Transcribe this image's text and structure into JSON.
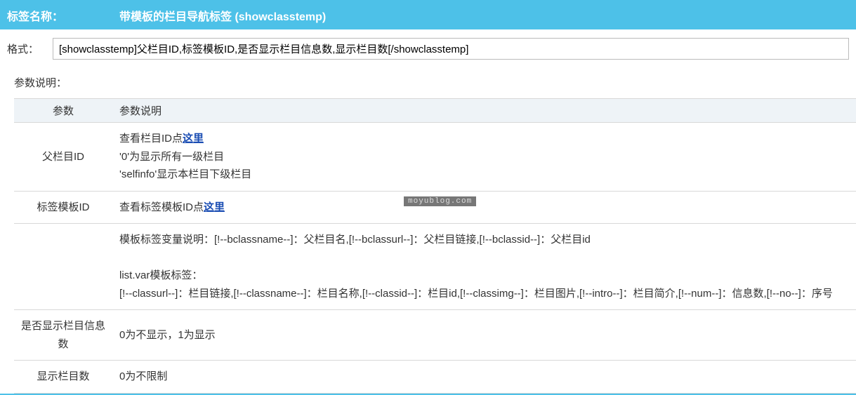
{
  "header": {
    "label": "标签名称：",
    "title": "带模板的栏目导航标签 (showclasstemp)"
  },
  "format": {
    "label": "格式：",
    "value": "[showclasstemp]父栏目ID,标签模板ID,是否显示栏目信息数,显示栏目数[/showclasstemp]"
  },
  "section_title": "参数说明：",
  "table": {
    "headers": {
      "col1": "参数",
      "col2": "参数说明"
    },
    "rows": [
      {
        "name": "父栏目ID",
        "desc_pre": "查看栏目ID点",
        "link": "这里",
        "desc_line2": "'0'为显示所有一级栏目",
        "desc_line3": "'selfinfo'显示本栏目下级栏目"
      },
      {
        "name": "标签模板ID",
        "desc_pre": "查看标签模板ID点",
        "link": "这里"
      },
      {
        "name": "",
        "desc_line1": "模板标签变量说明：[!--bclassname--]：父栏目名,[!--bclassurl--]：父栏目链接,[!--bclassid--]：父栏目id",
        "desc_line2": "list.var模板标签：",
        "desc_line3": "[!--classurl--]：栏目链接,[!--classname--]：栏目名称,[!--classid--]：栏目id,[!--classimg--]：栏目图片,[!--intro--]：栏目简介,[!--num--]：信息数,[!--no--]：序号"
      },
      {
        "name": "是否显示栏目信息数",
        "desc": "0为不显示，1为显示"
      },
      {
        "name": "显示栏目数",
        "desc": "0为不限制"
      }
    ]
  },
  "watermark": "moyublog.com"
}
